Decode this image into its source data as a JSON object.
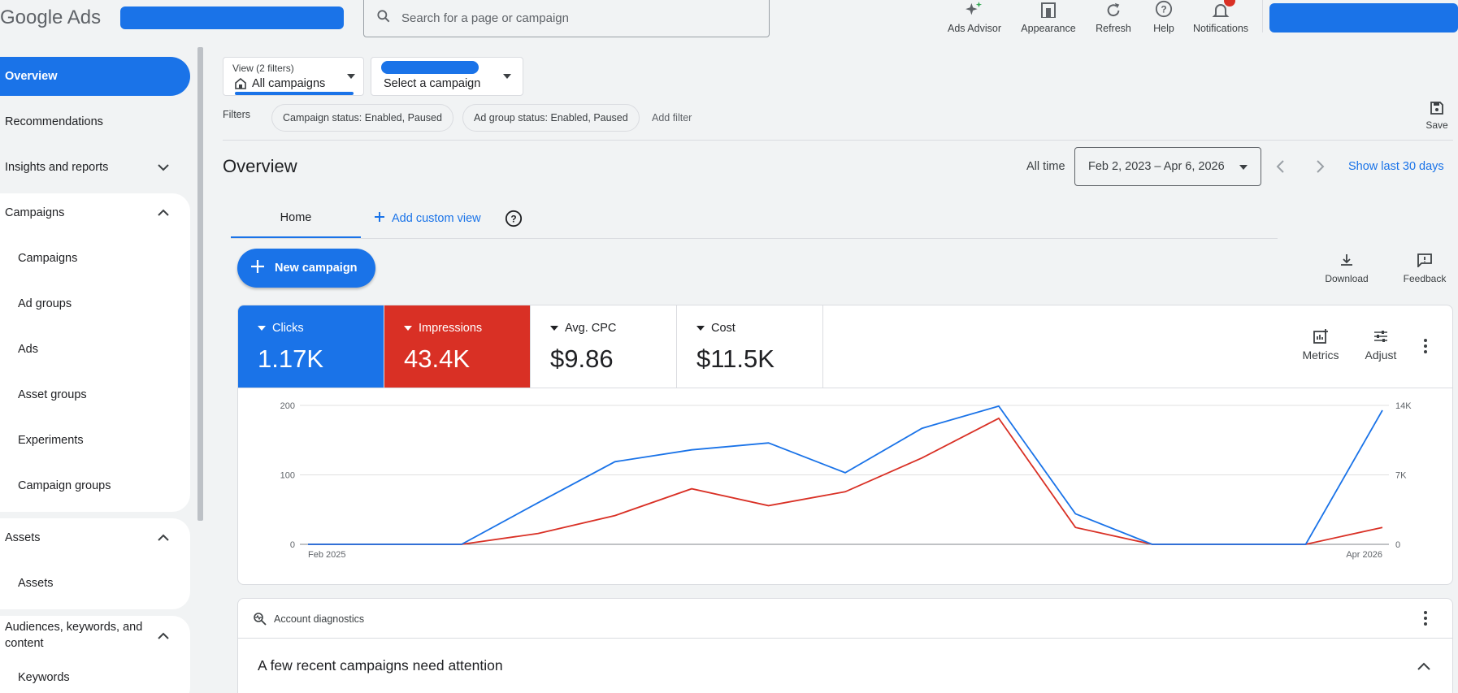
{
  "app": {
    "logo": "Google Ads"
  },
  "search": {
    "placeholder": "Search for a page or campaign"
  },
  "top_actions": [
    {
      "label": "Ads Advisor",
      "icon": "sparkle-icon"
    },
    {
      "label": "Appearance",
      "icon": "appearance-icon"
    },
    {
      "label": "Refresh",
      "icon": "refresh-icon"
    },
    {
      "label": "Help",
      "icon": "help-icon"
    },
    {
      "label": "Notifications",
      "icon": "bell-icon"
    }
  ],
  "sidebar": {
    "overview": "Overview",
    "recommendations": "Recommendations",
    "insights": "Insights and reports",
    "campaigns_header": "Campaigns",
    "campaign_items": [
      "Campaigns",
      "Ad groups",
      "Ads",
      "Asset groups",
      "Experiments",
      "Campaign groups"
    ],
    "assets_header": "Assets",
    "assets_item": "Assets",
    "audiences_header": "Audiences, keywords, and content",
    "keywords_item": "Keywords"
  },
  "view": {
    "picker_label": "View (2 filters)",
    "picker_value": "All campaigns",
    "campaign_select": "Select a campaign"
  },
  "filters": {
    "label": "Filters",
    "chips": [
      "Campaign status: Enabled, Paused",
      "Ad group status: Enabled, Paused"
    ],
    "add": "Add filter",
    "save": "Save"
  },
  "page": {
    "title": "Overview",
    "range_label": "All time",
    "date_range": "Feb 2, 2023 – Apr 6, 2026",
    "show_last": "Show last 30 days"
  },
  "tabs": {
    "home": "Home",
    "add_custom": "Add custom view"
  },
  "actions": {
    "new_campaign": "New campaign",
    "download": "Download",
    "feedback": "Feedback"
  },
  "metrics": [
    {
      "name": "Clicks",
      "value": "1.17K",
      "color": "#1a73e8",
      "active": true
    },
    {
      "name": "Impressions",
      "value": "43.4K",
      "color": "#d93025",
      "active": true
    },
    {
      "name": "Avg. CPC",
      "value": "$9.86",
      "active": false
    },
    {
      "name": "Cost",
      "value": "$11.5K",
      "active": false
    }
  ],
  "metric_tools": {
    "metrics": "Metrics",
    "adjust": "Adjust"
  },
  "chart_data": {
    "type": "line",
    "x_start_label": "Feb 2025",
    "x_end_label": "Apr 2026",
    "left_ticks": [
      "0",
      "100",
      "200"
    ],
    "right_ticks": [
      "0",
      "7K",
      "14K"
    ],
    "left_ylim": [
      0,
      200
    ],
    "right_ylim": [
      0,
      14000
    ],
    "grid": true,
    "series": [
      {
        "name": "Clicks",
        "axis": "left",
        "color": "#1a73e8",
        "values": [
          0,
          0,
          0,
          60,
          119,
          136,
          146,
          103,
          167,
          199,
          44,
          0,
          0,
          0,
          193
        ]
      },
      {
        "name": "Impressions",
        "axis": "right",
        "color": "#d93025",
        "values": [
          0,
          0,
          0,
          1100,
          2900,
          5600,
          3900,
          5300,
          8700,
          12700,
          1700,
          0,
          0,
          0,
          1700
        ]
      }
    ]
  },
  "diagnostics": {
    "title": "Account diagnostics",
    "heading": "A few recent campaigns need attention"
  }
}
